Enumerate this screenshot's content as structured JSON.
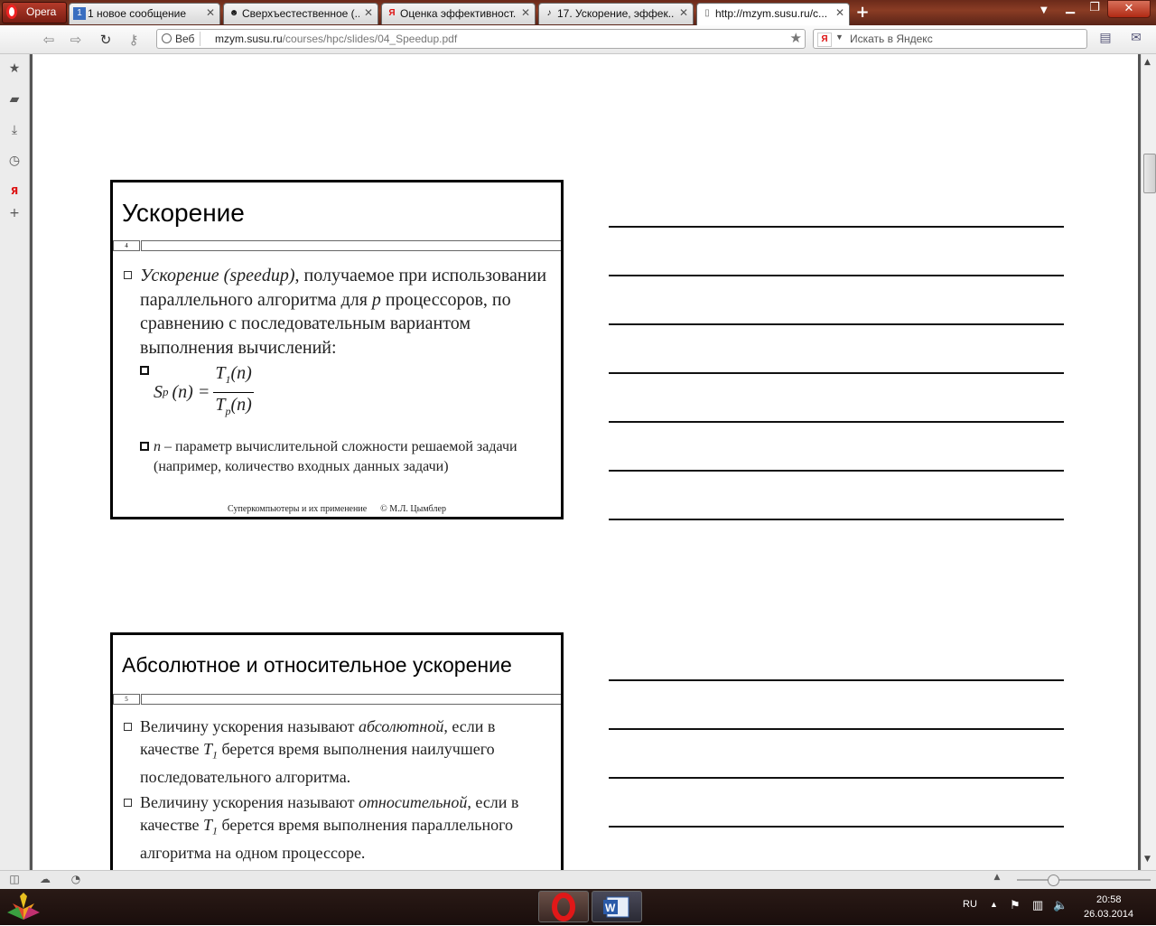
{
  "browser": {
    "menu_label": "Opera",
    "tabs": [
      {
        "label": "1 новое сообщение",
        "icon": "1"
      },
      {
        "label": "Сверхъестественное (...",
        "icon": "☻"
      },
      {
        "label": "Оценка эффективност...",
        "icon": "Я"
      },
      {
        "label": "17. Ускорение, эффек...",
        "icon": "♪"
      },
      {
        "label": "http://mzym.susu.ru/c...",
        "icon": "▯"
      }
    ],
    "address": {
      "web_label": "Веб",
      "domain": "mzym.susu.ru",
      "path": "/courses/hpc/slides/04_Speedup.pdf"
    },
    "search_placeholder": "Искать в Яндекс"
  },
  "slides": [
    {
      "title": "Ускорение",
      "number": "4",
      "bullet_italic": "Ускорение (speedup)",
      "bullet_rest": ", получаемое при использовании параллельного алгоритма для ",
      "bullet_p": "p",
      "bullet_tail": " процессоров, по сравнению с последовательным вариантом выполнения вычислений:",
      "formula": {
        "lhs_s": "S",
        "lhs_p": "p",
        "lhs_n": "(n) =",
        "num_t": "T",
        "num_sub": "1",
        "num_n": "(n)",
        "den_t": "T",
        "den_sub": "p",
        "den_n": "(n)"
      },
      "sub2_n": "n",
      "sub2_text": " – параметр вычислительной сложности решаемой задачи (например, количество входных данных задачи)",
      "footer_left": "Суперкомпьютеры и их применение",
      "footer_right": "© М.Л. Цымблер"
    },
    {
      "title": "Абсолютное и относительное ускорение",
      "number": "5",
      "b1_a": "Величину ускорения называют ",
      "b1_i": "абсолютной",
      "b1_b": ", если в качестве ",
      "b1_t": "T",
      "b1_sub": "1",
      "b1_c": " берется время выполнения наилучшего последовательного алгоритма.",
      "b2_a": "Величину ускорения называют ",
      "b2_i": "относительной",
      "b2_b": ", если в качестве ",
      "b2_t": "T",
      "b2_sub": "1",
      "b2_c": " берется время выполнения параллельного алгоритма на одном процессоре."
    }
  ],
  "taskbar": {
    "lang": "RU",
    "time": "20:58",
    "date": "26.03.2014"
  }
}
